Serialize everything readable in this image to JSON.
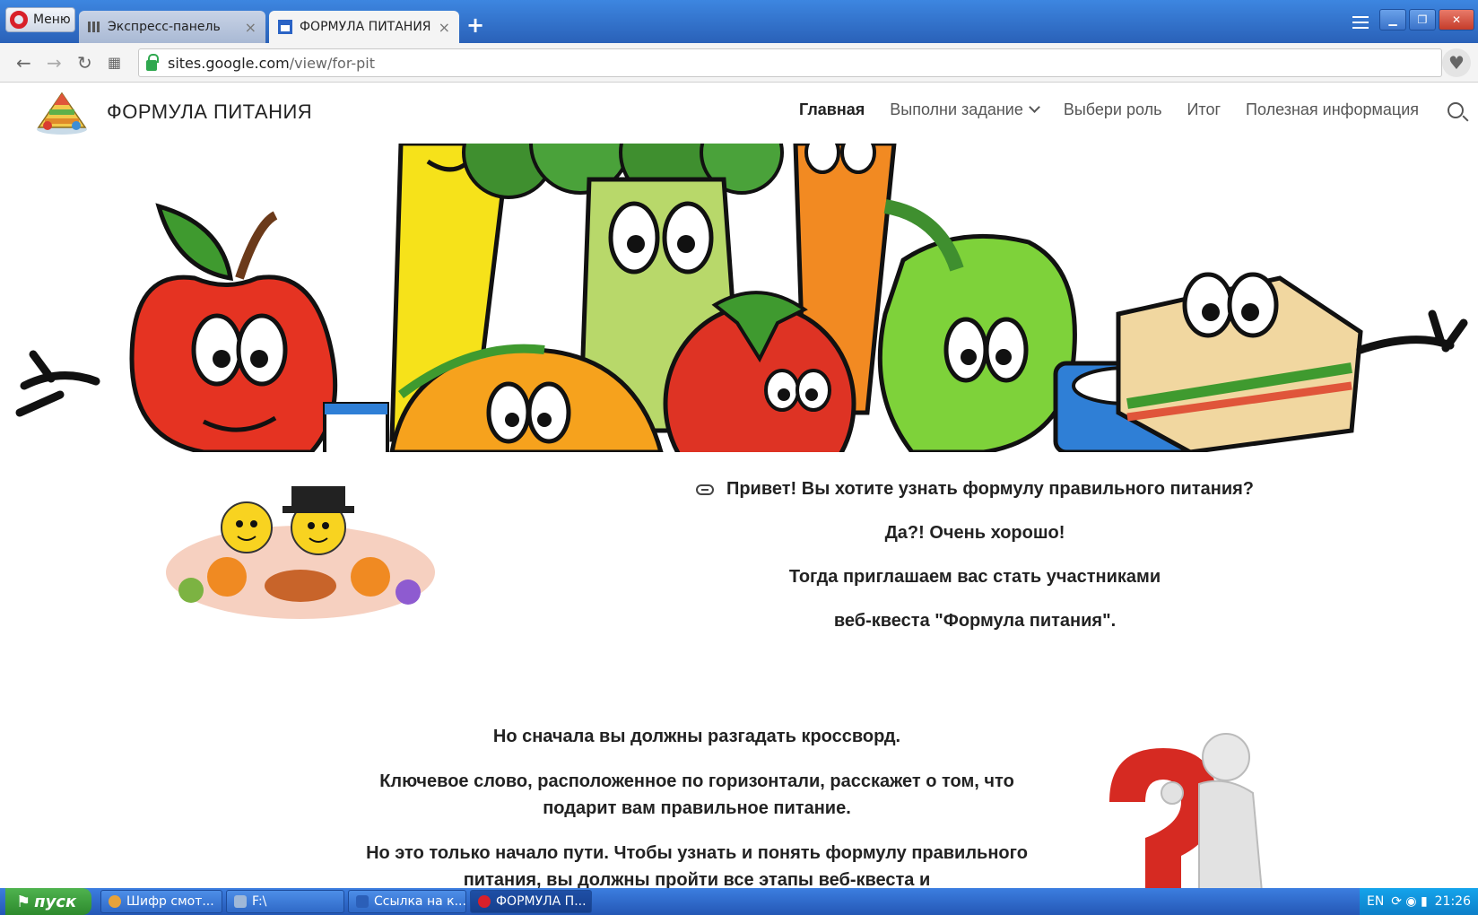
{
  "browser": {
    "menu_label": "Меню",
    "tabs": [
      {
        "title": "Экспресс-панель",
        "close": "×"
      },
      {
        "title": "ФОРМУЛА ПИТАНИЯ",
        "close": "×"
      }
    ],
    "new_tab_label": "+",
    "url_host": "sites.google.com",
    "url_path": "/view/for-pit"
  },
  "site": {
    "title": "ФОРМУЛА ПИТАНИЯ",
    "nav": [
      {
        "label": "Главная",
        "active": true
      },
      {
        "label": "Выполни задание",
        "has_dropdown": true
      },
      {
        "label": "Выбери роль"
      },
      {
        "label": "Итог"
      },
      {
        "label": "Полезная информация"
      }
    ]
  },
  "content": {
    "intro": [
      "Привет! Вы хотите узнать формулу правильного питания?",
      "Да?! Очень хорошо!",
      "Тогда приглашаем вас стать участниками",
      "веб-квеста \"Формула питания\"."
    ],
    "body": [
      "Но сначала вы должны разгадать кроссворд.",
      "Ключевое слово, расположенное по горизонтали, расскажет о том, что подарит вам правильное питание.",
      "Но это только начало пути. Чтобы узнать и понять формулу правильного питания, вы должны пройти все этапы веб-квеста и"
    ]
  },
  "taskbar": {
    "start_label": "пуск",
    "tasks": [
      {
        "label": "Шифр смот...",
        "icon_color": "#e8a33a"
      },
      {
        "label": "F:\\",
        "icon_color": "#9fb8d8"
      },
      {
        "label": "Ссылка на к...",
        "icon_color": "#2b5fb8"
      },
      {
        "label": "ФОРМУЛА П...",
        "icon_color": "#d8202a",
        "active": true
      }
    ],
    "tray_lang": "EN",
    "clock": "21:26"
  },
  "colors": {
    "tabbar": "#2f6fc7",
    "taskbar": "#2457b5",
    "start": "#3c9c3c",
    "text": "#222222"
  }
}
